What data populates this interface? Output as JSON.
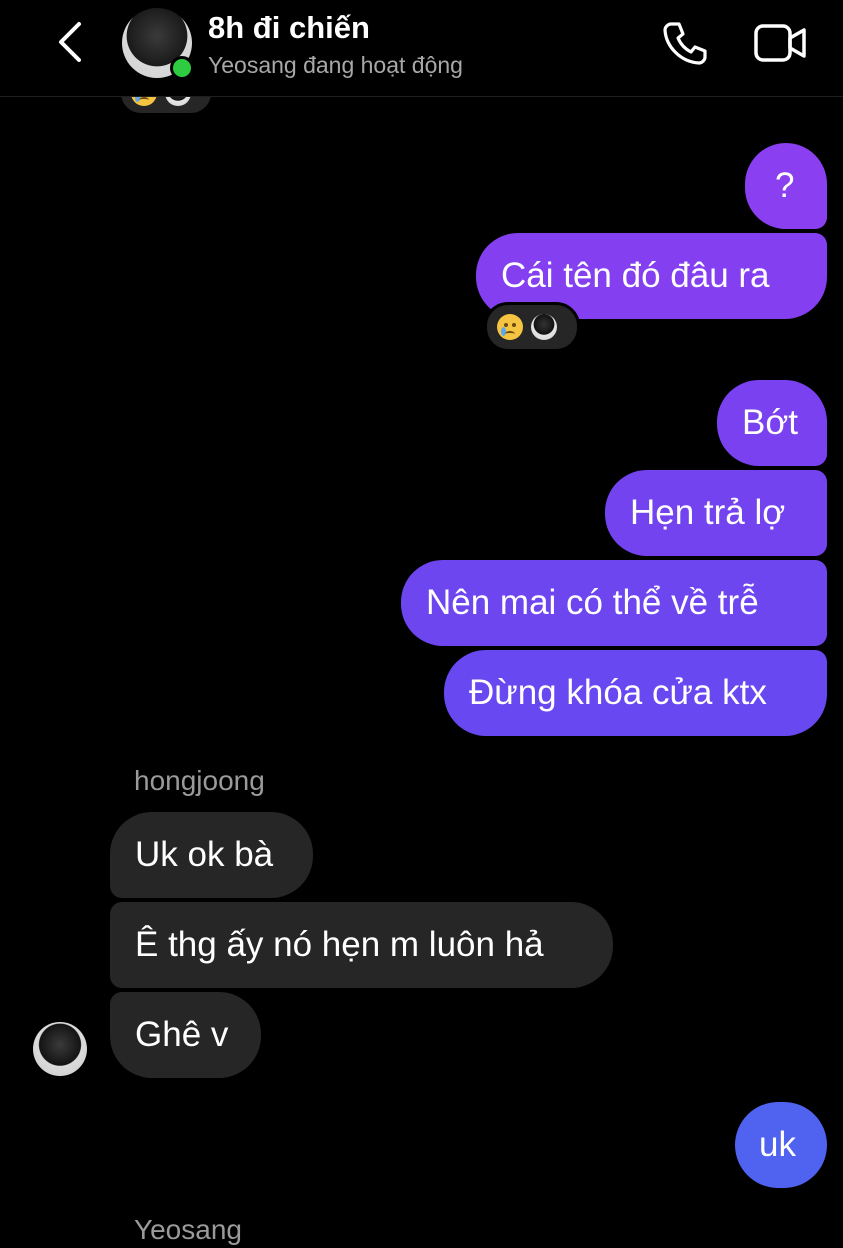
{
  "header": {
    "title": "8h đi chiến",
    "status": "Yeosang đang hoạt động"
  },
  "colors": {
    "outgoing_gradient_top": "#8a3ff0",
    "outgoing_gradient_bottom": "#4f62f0",
    "incoming_bubble": "#262626",
    "online": "#2ecc40"
  },
  "icons": {
    "back": "chevron-left-icon",
    "call": "phone-icon",
    "video": "video-camera-icon",
    "reaction_1": "crying-face-icon",
    "reaction_2": "user-avatar-icon"
  },
  "messages": {
    "outgoing_group_1": [
      "?",
      "Cái tên đó đâu ra"
    ],
    "outgoing_group_2": [
      "Bớt",
      "Hẹn trả lợ",
      "Nên mai có thể về trễ",
      "Đừng khóa cửa ktx"
    ],
    "incoming_sender": "hongjoong",
    "incoming_group": [
      "Uk ok bà",
      "Ê thg ấy nó hẹn m luôn hả",
      "Ghê v"
    ],
    "outgoing_group_3": [
      "uk"
    ],
    "next_sender": "Yeosang"
  }
}
